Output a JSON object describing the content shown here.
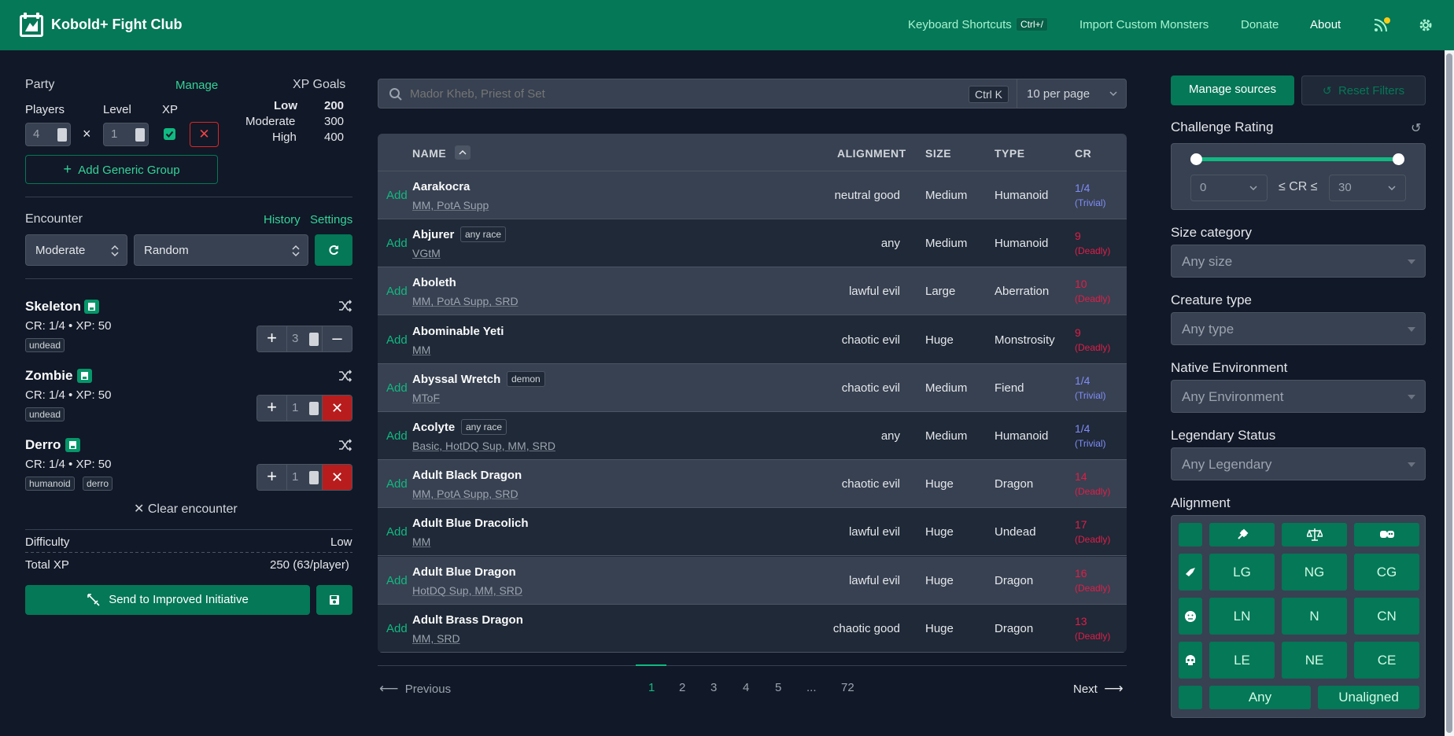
{
  "nav": {
    "title": "Kobold+ Fight Club",
    "keyboard_shortcuts": "Keyboard Shortcuts",
    "keyboard_kbd": "Ctrl+/",
    "import": "Import Custom Monsters",
    "donate": "Donate",
    "about": "About",
    "rss_icon": "rss-icon",
    "gear_icon": "gear-icon"
  },
  "party": {
    "title": "Party",
    "manage": "Manage",
    "players_label": "Players",
    "level_label": "Level",
    "xp_label": "XP",
    "players_value": "4",
    "level_value": "1",
    "times": "×",
    "add_group": "Add Generic Group",
    "xp_goals_title": "XP Goals",
    "goals": [
      {
        "label": "Low",
        "value": "200"
      },
      {
        "label": "Moderate",
        "value": "300"
      },
      {
        "label": "High",
        "value": "400"
      }
    ]
  },
  "encounter": {
    "title": "Encounter",
    "history": "History",
    "settings": "Settings",
    "difficulty_select": "Moderate",
    "strategy_select": "Random",
    "monsters": [
      {
        "name": "Skeleton",
        "info": "CR: 1/4 • XP: 50",
        "tags": [
          "undead"
        ],
        "count": "3"
      },
      {
        "name": "Zombie",
        "info": "CR: 1/4 • XP: 50",
        "tags": [
          "undead"
        ],
        "count": "1"
      },
      {
        "name": "Derro",
        "info": "CR: 1/4 • XP: 50",
        "tags": [
          "humanoid",
          "derro"
        ],
        "count": "1"
      }
    ],
    "clear": "Clear encounter",
    "difficulty_label": "Difficulty",
    "difficulty_value": "Low",
    "total_label": "Total XP",
    "total_value": "250 (63/player)",
    "send_button": "Send to Improved Initiative"
  },
  "search": {
    "placeholder": "Mador Kheb, Priest of Set",
    "kbd": "Ctrl K",
    "per_page": "10 per page"
  },
  "table": {
    "headers": {
      "name": "NAME",
      "alignment": "ALIGNMENT",
      "size": "SIZE",
      "type": "TYPE",
      "cr": "CR"
    },
    "add_label": "Add",
    "rows": [
      {
        "name": "Aarakocra",
        "tag": "",
        "sources": "MM, PotA Supp",
        "alignment": "neutral good",
        "size": "Medium",
        "type": "Humanoid",
        "cr": "1/4",
        "difficulty": "(Trivial)"
      },
      {
        "name": "Abjurer",
        "tag": "any race",
        "sources": "VGtM",
        "alignment": "any",
        "size": "Medium",
        "type": "Humanoid",
        "cr": "9",
        "difficulty": "(Deadly)"
      },
      {
        "name": "Aboleth",
        "tag": "",
        "sources": "MM, PotA Supp, SRD",
        "alignment": "lawful evil",
        "size": "Large",
        "type": "Aberration",
        "cr": "10",
        "difficulty": "(Deadly)"
      },
      {
        "name": "Abominable Yeti",
        "tag": "",
        "sources": "MM",
        "alignment": "chaotic evil",
        "size": "Huge",
        "type": "Monstrosity",
        "cr": "9",
        "difficulty": "(Deadly)"
      },
      {
        "name": "Abyssal Wretch",
        "tag": "demon",
        "sources": "MToF",
        "alignment": "chaotic evil",
        "size": "Medium",
        "type": "Fiend",
        "cr": "1/4",
        "difficulty": "(Trivial)"
      },
      {
        "name": "Acolyte",
        "tag": "any race",
        "sources": "Basic, HotDQ Sup, MM, SRD",
        "alignment": "any",
        "size": "Medium",
        "type": "Humanoid",
        "cr": "1/4",
        "difficulty": "(Trivial)"
      },
      {
        "name": "Adult Black Dragon",
        "tag": "",
        "sources": "MM, PotA Supp, SRD",
        "alignment": "chaotic evil",
        "size": "Huge",
        "type": "Dragon",
        "cr": "14",
        "difficulty": "(Deadly)"
      },
      {
        "name": "Adult Blue Dracolich",
        "tag": "",
        "sources": "MM",
        "alignment": "lawful evil",
        "size": "Huge",
        "type": "Undead",
        "cr": "17",
        "difficulty": "(Deadly)"
      },
      {
        "name": "Adult Blue Dragon",
        "tag": "",
        "sources": "HotDQ Sup, MM, SRD",
        "alignment": "lawful evil",
        "size": "Huge",
        "type": "Dragon",
        "cr": "16",
        "difficulty": "(Deadly)"
      },
      {
        "name": "Adult Brass Dragon",
        "tag": "",
        "sources": "MM, SRD",
        "alignment": "chaotic good",
        "size": "Huge",
        "type": "Dragon",
        "cr": "13",
        "difficulty": "(Deadly)"
      }
    ]
  },
  "pagination": {
    "previous": "Previous",
    "next": "Next",
    "pages": [
      "1",
      "2",
      "3",
      "4",
      "5",
      "...",
      "72"
    ],
    "current": "1"
  },
  "filters": {
    "manage_sources": "Manage sources",
    "reset_filters": "Reset Filters",
    "challenge_rating": "Challenge Rating",
    "cr_min": "0",
    "cr_max": "30",
    "cr_between": "≤ CR ≤",
    "cr_slider_min_fraction": 0,
    "cr_slider_max_fraction": 1,
    "size_label": "Size category",
    "size_value": "Any size",
    "type_label": "Creature type",
    "type_value": "Any type",
    "env_label": "Native Environment",
    "env_value": "Any Environment",
    "legendary_label": "Legendary Status",
    "legendary_value": "Any Legendary",
    "alignment_label": "Alignment",
    "alignment_grid": [
      [
        "LG",
        "NG",
        "CG"
      ],
      [
        "LN",
        "N",
        "CN"
      ],
      [
        "LE",
        "NE",
        "CE"
      ]
    ],
    "any": "Any",
    "unaligned": "Unaligned"
  },
  "colors": {
    "brand": "#047857",
    "accent": "#10b981",
    "trivial": "#818cf8",
    "deadly": "#e11d48",
    "danger": "#b91c1c",
    "background": "#111827"
  }
}
